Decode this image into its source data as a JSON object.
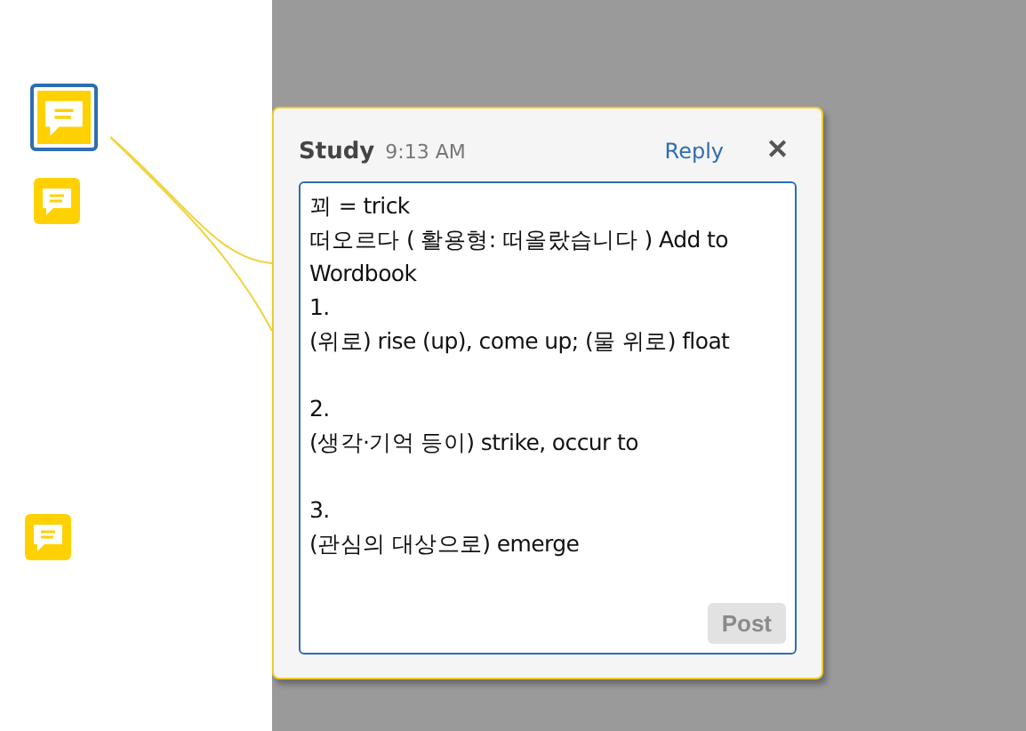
{
  "notes": [
    {
      "selected": true
    },
    {
      "selected": false
    },
    {
      "selected": false
    }
  ],
  "popup": {
    "author": "Study",
    "time": "9:13 AM",
    "reply": "Reply",
    "close": "✕",
    "text": [
      [
        "꾀 = trick",
        "떠오르다 ( 활용형: 떠올랐습니다 ) Add to Wordbook",
        "1.",
        "(위로) rise (up), come up; (물 위로) float"
      ],
      [
        "2.",
        "(생각·기억 등이) strike, occur to"
      ],
      [
        "3.",
        "(관심의 대상으로) emerge"
      ]
    ],
    "post": {
      "label": "Post",
      "disabled": true
    }
  }
}
